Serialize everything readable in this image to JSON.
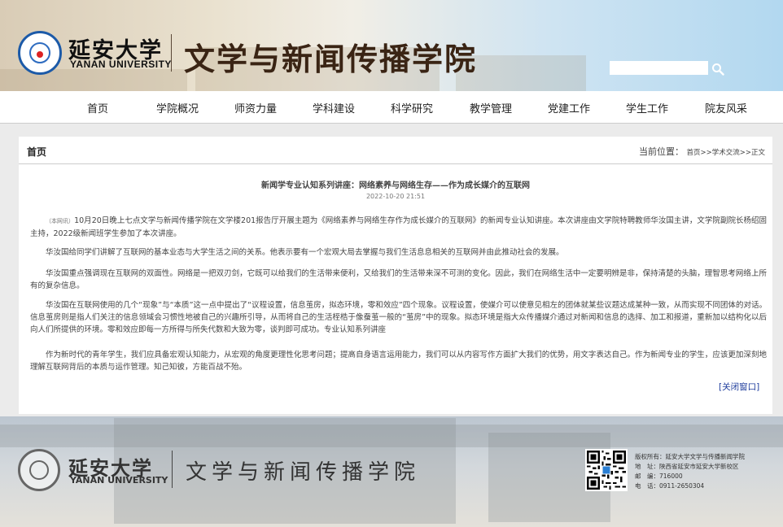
{
  "header": {
    "logo_cn": "延安大学",
    "logo_en": "YANAN UNIVERSITY",
    "college_name": "文学与新闻传播学院",
    "search_placeholder": ""
  },
  "nav": {
    "items": [
      {
        "label": "首页"
      },
      {
        "label": "学院概况"
      },
      {
        "label": "师资力量"
      },
      {
        "label": "学科建设"
      },
      {
        "label": "科学研究"
      },
      {
        "label": "教学管理"
      },
      {
        "label": "党建工作"
      },
      {
        "label": "学生工作"
      },
      {
        "label": "院友风采"
      }
    ]
  },
  "breadcrumb": {
    "home": "首页",
    "location_label": "当前位置：",
    "path": [
      {
        "label": "首页"
      },
      {
        "label": "学术交流"
      },
      {
        "label": "正文"
      }
    ],
    "separator": ">>"
  },
  "article": {
    "title": "新闻学专业认知系列讲座：网络素养与网络生存——作为成长媒介的互联网",
    "date": "2022-10-20 21:51",
    "source_tag": "（本网讯）",
    "paragraphs": [
      "10月20日晚上七点文学与新闻传播学院在文学楼201报告厅开展主题为《网络素养与网络生存作为成长媒介的互联网》的新闻专业认知讲座。本次讲座由文学院特聘教师华汝国主讲，文学院副院长杨绍固主持，2022级新闻班学生参加了本次讲座。",
      "华汝国给同学们讲解了互联网的基本业态与大学生活之间的关系。他表示要有一个宏观大局去掌握与我们生活息息相关的互联网并由此推动社会的发展。",
      "华汝国重点强调现在互联网的双面性。网络是一把双刃剑，它既可以给我们的生活带来便利，又给我们的生活带来深不可测的变化。因此，我们在网络生活中一定要明辨是非，保持清楚的头脑，理智思考网络上所有的复杂信息。",
      "华汝国在互联网使用的几个“现象”与“本质”这一点中提出了“议程设置，信息茧房，拟态环境，零和效应”四个现象。议程设置，使媒介可以使意见相左的团体就某些议题达成某种一致，从而实现不同团体的对话。信息茧房则是指人们关注的信息领域会习惯性地被自己的兴趣所引导，从而将自己的生活桎梏于像蚕茧一般的“茧房”中的现象。拟态环境是指大众传播媒介通过对新闻和信息的选择、加工和报道，重新加以结构化以后向人们所提供的环境。零和效应即每一方所得与所失代数和大致为零，谈判即可成功。专业认知系列讲座",
      "作为新时代的青年学生，我们应具备宏观认知能力，从宏观的角度更理性化思考问题；提高自身语言运用能力，我们可以从内容写作方面扩大我们的优势，用文字表达自己。作为新闻专业的学生，应该更加深刻地理解互联网背后的本质与运作管理。知己知彼，方能百战不殆。"
    ],
    "close_label": "[关闭窗口]"
  },
  "footer": {
    "logo_cn": "延安大学",
    "logo_en": "YANAN UNIVERSITY",
    "college_name": "文学与新闻传播学院",
    "info": [
      "版权所有：延安大学文学与传播新闻学院",
      "地　址：陕西省延安市延安大学新校区",
      "邮　编：716000",
      "电　话：0911-2650304"
    ]
  },
  "colors": {
    "nav_text": "#222222",
    "link_blue": "#1e3c9c",
    "title_brown": "#3a2414",
    "page_gray": "#ebebeb"
  },
  "icons": {
    "search": "search-icon",
    "qr": "qr-code-icon",
    "seal": "university-seal-icon"
  }
}
